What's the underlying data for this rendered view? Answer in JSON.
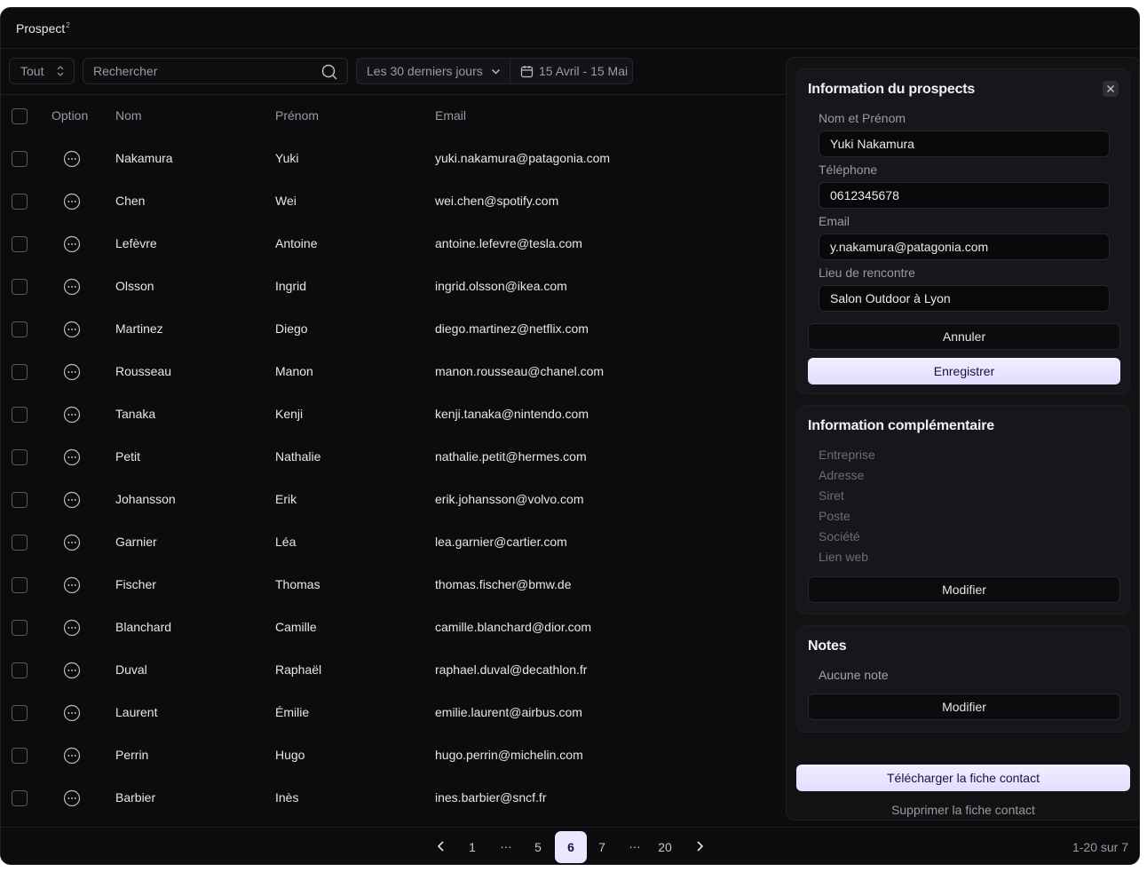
{
  "app": {
    "title": "Prospect",
    "title_sup": "2"
  },
  "toolbar": {
    "filter_value": "Tout",
    "search_placeholder": "Rechercher",
    "date_range": "Les 30 derniers jours",
    "dates": "15 Avril - 15 Mai"
  },
  "table": {
    "headers": {
      "option": "Option",
      "nom": "Nom",
      "prenom": "Prénom",
      "email": "Email"
    },
    "rows": [
      {
        "nom": "Nakamura",
        "prenom": "Yuki",
        "email": "yuki.nakamura@patagonia.com"
      },
      {
        "nom": "Chen",
        "prenom": "Wei",
        "email": "wei.chen@spotify.com"
      },
      {
        "nom": "Lefèvre",
        "prenom": "Antoine",
        "email": "antoine.lefevre@tesla.com"
      },
      {
        "nom": "Olsson",
        "prenom": "Ingrid",
        "email": "ingrid.olsson@ikea.com"
      },
      {
        "nom": "Martinez",
        "prenom": "Diego",
        "email": "diego.martinez@netflix.com"
      },
      {
        "nom": "Rousseau",
        "prenom": "Manon",
        "email": "manon.rousseau@chanel.com"
      },
      {
        "nom": "Tanaka",
        "prenom": "Kenji",
        "email": "kenji.tanaka@nintendo.com"
      },
      {
        "nom": "Petit",
        "prenom": "Nathalie",
        "email": "nathalie.petit@hermes.com"
      },
      {
        "nom": "Johansson",
        "prenom": "Erik",
        "email": "erik.johansson@volvo.com"
      },
      {
        "nom": "Garnier",
        "prenom": "Léa",
        "email": "lea.garnier@cartier.com"
      },
      {
        "nom": "Fischer",
        "prenom": "Thomas",
        "email": "thomas.fischer@bmw.de"
      },
      {
        "nom": "Blanchard",
        "prenom": "Camille",
        "email": "camille.blanchard@dior.com"
      },
      {
        "nom": "Duval",
        "prenom": "Raphaël",
        "email": "raphael.duval@decathlon.fr"
      },
      {
        "nom": "Laurent",
        "prenom": "Émilie",
        "email": "emilie.laurent@airbus.com"
      },
      {
        "nom": "Perrin",
        "prenom": "Hugo",
        "email": "hugo.perrin@michelin.com"
      },
      {
        "nom": "Barbier",
        "prenom": "Inès",
        "email": "ines.barbier@sncf.fr"
      }
    ]
  },
  "pagination": {
    "pages": [
      "1",
      "…",
      "5",
      "6",
      "7",
      "…",
      "20"
    ],
    "active": "6",
    "count": "1-20 sur 7"
  },
  "panel": {
    "prospect": {
      "title": "Information du prospects",
      "name_label": "Nom et Prénom",
      "name_value": "Yuki Nakamura",
      "phone_label": "Téléphone",
      "phone_value": "0612345678",
      "email_label": "Email",
      "email_value": "y.nakamura@patagonia.com",
      "place_label": "Lieu de rencontre",
      "place_value": "Salon Outdoor à Lyon",
      "cancel": "Annuler",
      "save": "Enregistrer"
    },
    "extra": {
      "title": "Information complémentaire",
      "fields": [
        "Entreprise",
        "Adresse",
        "Siret",
        "Poste",
        "Société",
        "Lien web"
      ],
      "edit": "Modifier"
    },
    "notes": {
      "title": "Notes",
      "empty": "Aucune note",
      "edit": "Modifier"
    },
    "download": "Télécharger la fiche contact",
    "delete": "Supprimer la fiche contact"
  },
  "colors": {
    "background": "#0c0c0e",
    "accent": "#ece7ff",
    "panel": "#17171b"
  }
}
